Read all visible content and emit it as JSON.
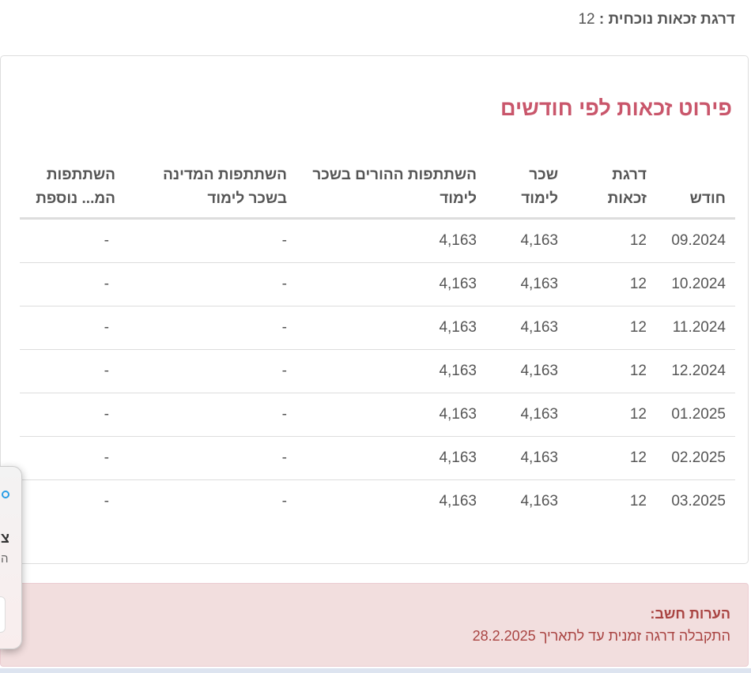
{
  "current_grade": {
    "label": "דרגת זכאות נוכחית :",
    "value": "12"
  },
  "title": "פירוט זכאות לפי חודשים",
  "table": {
    "headers": [
      "חודש",
      "דרגת זכאות",
      "שכר לימוד",
      "השתתפות ההורים בשכר לימוד",
      "השתתפות המדינה בשכר לימוד",
      "השתתפות המ... נוספת"
    ],
    "rows": [
      [
        "09.2024",
        "12",
        "4,163",
        "4,163",
        "-",
        "-"
      ],
      [
        "10.2024",
        "12",
        "4,163",
        "4,163",
        "-",
        "-"
      ],
      [
        "11.2024",
        "12",
        "4,163",
        "4,163",
        "-",
        "-"
      ],
      [
        "12.2024",
        "12",
        "4,163",
        "4,163",
        "-",
        "-"
      ],
      [
        "01.2025",
        "12",
        "4,163",
        "4,163",
        "-",
        "-"
      ],
      [
        "02.2025",
        "12",
        "4,163",
        "4,163",
        "-",
        "-"
      ],
      [
        "03.2025",
        "12",
        "4,163",
        "4,163",
        "-",
        "-"
      ]
    ]
  },
  "notes": {
    "heading": "הערות חשב:",
    "text": "התקבלה דרגה זמנית עד לתאריך 28.2.2025"
  },
  "popup": {
    "line1": "צ",
    "line2": "ה"
  },
  "colors": {
    "title": "#c9566b",
    "alert_bg": "#f2dede",
    "alert_text": "#a94442"
  }
}
